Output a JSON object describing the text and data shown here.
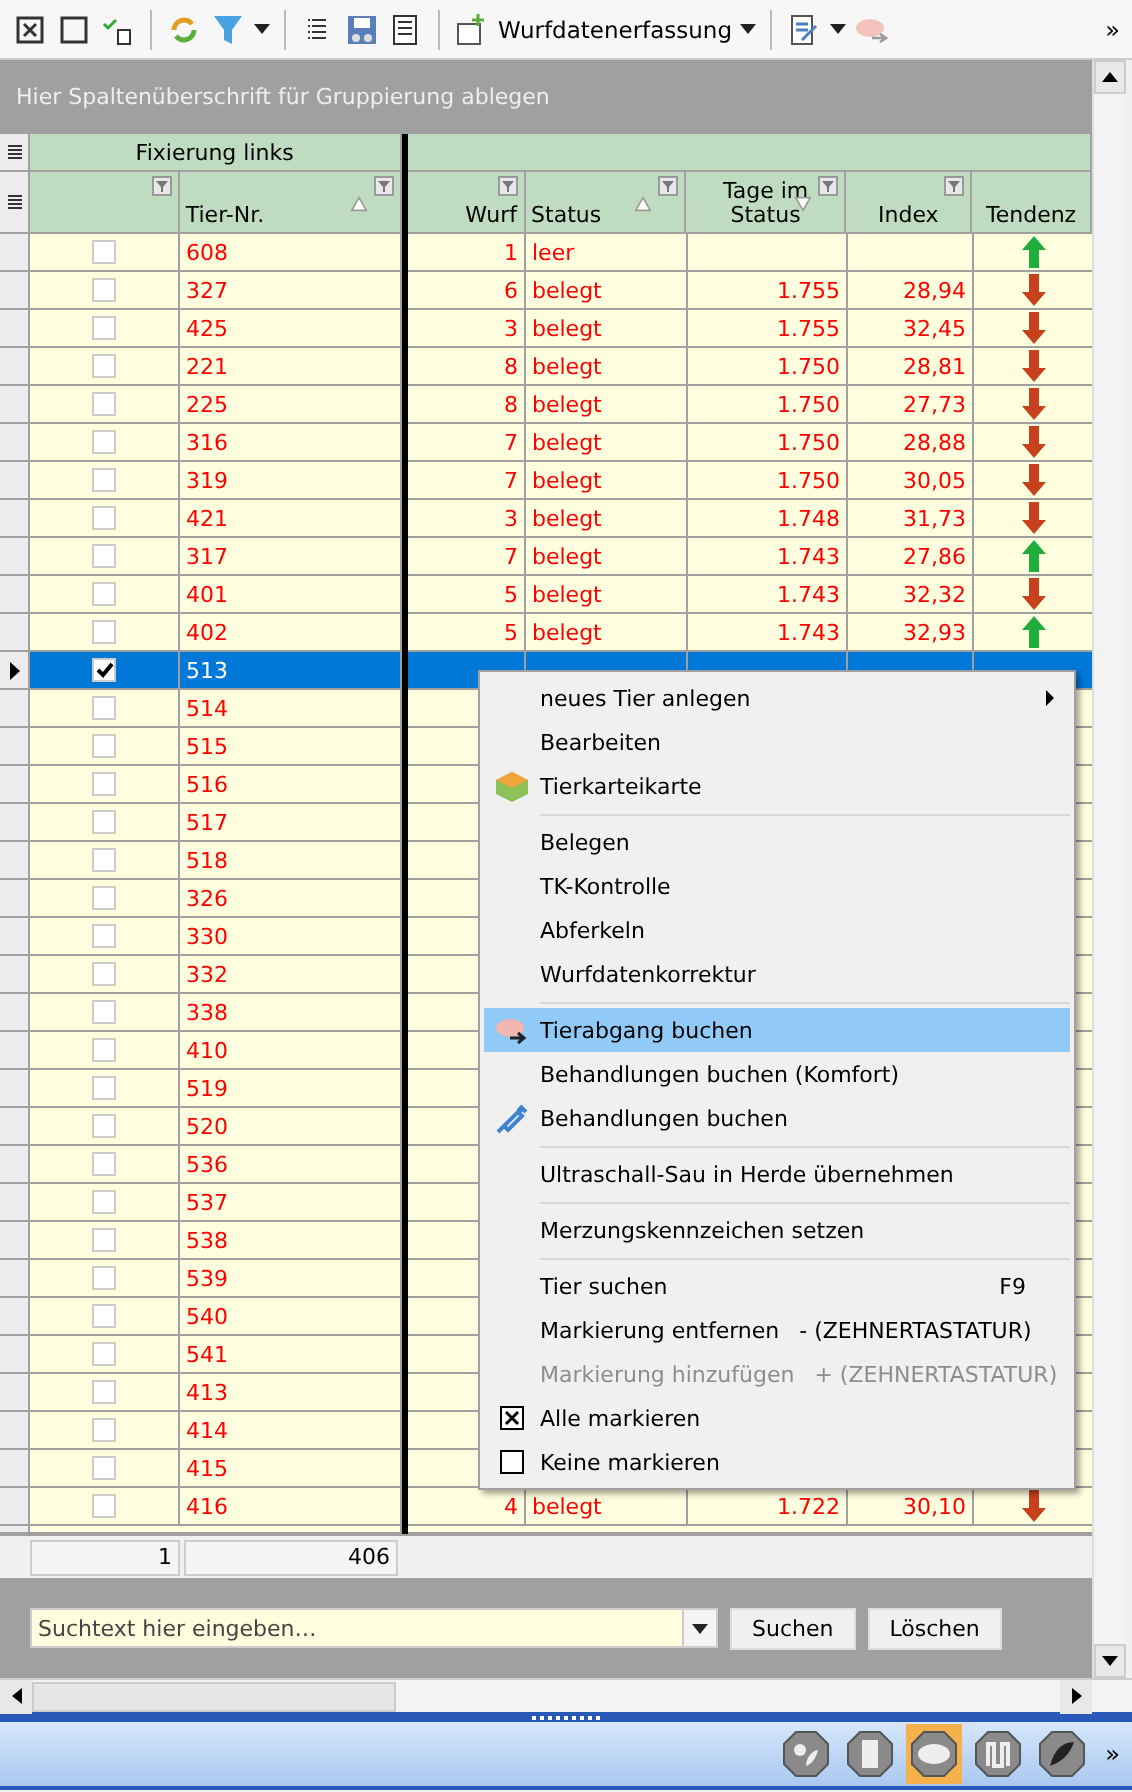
{
  "toolbar": {
    "view_dropdown": "Wurfdatenerfassung",
    "overflow": "»"
  },
  "group_panel": {
    "hint": "Hier Spaltenüberschrift für Gruppierung ablegen"
  },
  "grid": {
    "band_left": "Fixierung links",
    "columns": [
      {
        "filter": true,
        "sorted_ascending": false,
        "sorted_descending": false
      },
      {
        "label": "Tier-Nr.",
        "filter": true,
        "sorted_ascending": true,
        "sorted_descending": false
      },
      {
        "label": "Wurf",
        "filter": true,
        "sorted_ascending": false,
        "sorted_descending": false
      },
      {
        "label": "Status",
        "filter": true,
        "sorted_ascending": true,
        "sorted_descending": false
      },
      {
        "label": "Tage im Status",
        "filter": true,
        "sorted_ascending": false,
        "sorted_descending": true
      },
      {
        "label": "Index",
        "filter": true,
        "sorted_ascending": false,
        "sorted_descending": false
      },
      {
        "label": "Tendenz",
        "filter": false,
        "sorted_ascending": false,
        "sorted_descending": false
      }
    ],
    "rows": [
      {
        "checked": false,
        "selected": false,
        "tier": "608",
        "wurf": "1",
        "status": "leer",
        "tage": "",
        "index": "",
        "trend_up": true
      },
      {
        "checked": false,
        "selected": false,
        "tier": "327",
        "wurf": "6",
        "status": "belegt",
        "tage": "1.755",
        "index": "28,94",
        "trend_up": false
      },
      {
        "checked": false,
        "selected": false,
        "tier": "425",
        "wurf": "3",
        "status": "belegt",
        "tage": "1.755",
        "index": "32,45",
        "trend_up": false
      },
      {
        "checked": false,
        "selected": false,
        "tier": "221",
        "wurf": "8",
        "status": "belegt",
        "tage": "1.750",
        "index": "28,81",
        "trend_up": false
      },
      {
        "checked": false,
        "selected": false,
        "tier": "225",
        "wurf": "8",
        "status": "belegt",
        "tage": "1.750",
        "index": "27,73",
        "trend_up": false
      },
      {
        "checked": false,
        "selected": false,
        "tier": "316",
        "wurf": "7",
        "status": "belegt",
        "tage": "1.750",
        "index": "28,88",
        "trend_up": false
      },
      {
        "checked": false,
        "selected": false,
        "tier": "319",
        "wurf": "7",
        "status": "belegt",
        "tage": "1.750",
        "index": "30,05",
        "trend_up": false
      },
      {
        "checked": false,
        "selected": false,
        "tier": "421",
        "wurf": "3",
        "status": "belegt",
        "tage": "1.748",
        "index": "31,73",
        "trend_up": false
      },
      {
        "checked": false,
        "selected": false,
        "tier": "317",
        "wurf": "7",
        "status": "belegt",
        "tage": "1.743",
        "index": "27,86",
        "trend_up": true
      },
      {
        "checked": false,
        "selected": false,
        "tier": "401",
        "wurf": "5",
        "status": "belegt",
        "tage": "1.743",
        "index": "32,32",
        "trend_up": false
      },
      {
        "checked": false,
        "selected": false,
        "tier": "402",
        "wurf": "5",
        "status": "belegt",
        "tage": "1.743",
        "index": "32,93",
        "trend_up": true
      },
      {
        "checked": true,
        "selected": true,
        "tier": "513"
      },
      {
        "checked": false,
        "selected": false,
        "tier": "514"
      },
      {
        "checked": false,
        "selected": false,
        "tier": "515"
      },
      {
        "checked": false,
        "selected": false,
        "tier": "516"
      },
      {
        "checked": false,
        "selected": false,
        "tier": "517"
      },
      {
        "checked": false,
        "selected": false,
        "tier": "518"
      },
      {
        "checked": false,
        "selected": false,
        "tier": "326"
      },
      {
        "checked": false,
        "selected": false,
        "tier": "330"
      },
      {
        "checked": false,
        "selected": false,
        "tier": "332"
      },
      {
        "checked": false,
        "selected": false,
        "tier": "338"
      },
      {
        "checked": false,
        "selected": false,
        "tier": "410"
      },
      {
        "checked": false,
        "selected": false,
        "tier": "519"
      },
      {
        "checked": false,
        "selected": false,
        "tier": "520"
      },
      {
        "checked": false,
        "selected": false,
        "tier": "536"
      },
      {
        "checked": false,
        "selected": false,
        "tier": "537"
      },
      {
        "checked": false,
        "selected": false,
        "tier": "538"
      },
      {
        "checked": false,
        "selected": false,
        "tier": "539"
      },
      {
        "checked": false,
        "selected": false,
        "tier": "540"
      },
      {
        "checked": false,
        "selected": false,
        "tier": "541"
      },
      {
        "checked": false,
        "selected": false,
        "tier": "413"
      },
      {
        "checked": false,
        "selected": false,
        "tier": "414"
      },
      {
        "checked": false,
        "selected": false,
        "tier": "415"
      },
      {
        "checked": false,
        "selected": false,
        "tier": "416",
        "wurf": "4",
        "status": "belegt",
        "tage": "1.722",
        "index": "30,10",
        "trend_up": false
      }
    ],
    "summary": [
      "1",
      "406"
    ]
  },
  "search": {
    "placeholder": "Suchtext hier eingeben…",
    "buttons": [
      "Suchen",
      "Löschen"
    ]
  },
  "context_menu": [
    {
      "kind": "item",
      "label": "neues Tier anlegen",
      "submenu": true,
      "disabled": false,
      "selected": false
    },
    {
      "kind": "item",
      "label": "Bearbeiten",
      "submenu": false,
      "disabled": false,
      "selected": false
    },
    {
      "kind": "item",
      "label": "Tierkarteikarte",
      "submenu": false,
      "disabled": false,
      "selected": false
    },
    {
      "kind": "separator"
    },
    {
      "kind": "item",
      "label": "Belegen",
      "submenu": false,
      "disabled": false,
      "selected": false
    },
    {
      "kind": "item",
      "label": "TK-Kontrolle",
      "submenu": false,
      "disabled": false,
      "selected": false
    },
    {
      "kind": "item",
      "label": "Abferkeln",
      "submenu": false,
      "disabled": false,
      "selected": false
    },
    {
      "kind": "item",
      "label": "Wurfdatenkorrektur",
      "submenu": false,
      "disabled": false,
      "selected": false
    },
    {
      "kind": "separator"
    },
    {
      "kind": "item",
      "label": "Tierabgang buchen",
      "submenu": false,
      "disabled": false,
      "selected": true
    },
    {
      "kind": "item",
      "label": "Behandlungen buchen (Komfort)",
      "submenu": false,
      "disabled": false,
      "selected": false
    },
    {
      "kind": "item",
      "label": "Behandlungen buchen",
      "submenu": false,
      "disabled": false,
      "selected": false
    },
    {
      "kind": "separator"
    },
    {
      "kind": "item",
      "label": "Ultraschall-Sau in Herde übernehmen",
      "submenu": false,
      "disabled": false,
      "selected": false
    },
    {
      "kind": "separator"
    },
    {
      "kind": "item",
      "label": "Merzungskennzeichen setzen",
      "submenu": false,
      "disabled": false,
      "selected": false
    },
    {
      "kind": "separator"
    },
    {
      "kind": "item",
      "label": "Tier suchen",
      "shortcut": "F9",
      "submenu": false,
      "disabled": false,
      "selected": false
    },
    {
      "kind": "item",
      "label": "Markierung entfernen",
      "shortcut": "- (ZEHNERTASTATUR)",
      "submenu": false,
      "disabled": false,
      "selected": false
    },
    {
      "kind": "item",
      "label": "Markierung hinzufügen",
      "shortcut": "+ (ZEHNERTASTATUR)",
      "submenu": false,
      "disabled": true,
      "selected": false
    },
    {
      "kind": "check",
      "label": "Alle markieren",
      "checked": true,
      "disabled": false,
      "selected": false
    },
    {
      "kind": "check",
      "label": "Keine markieren",
      "checked": false,
      "disabled": false,
      "selected": false
    }
  ],
  "bottom_tabs": [
    {
      "selected": false
    },
    {
      "selected": false
    },
    {
      "selected": true
    },
    {
      "selected": false
    },
    {
      "selected": false
    }
  ],
  "bottom_overflow": "»"
}
